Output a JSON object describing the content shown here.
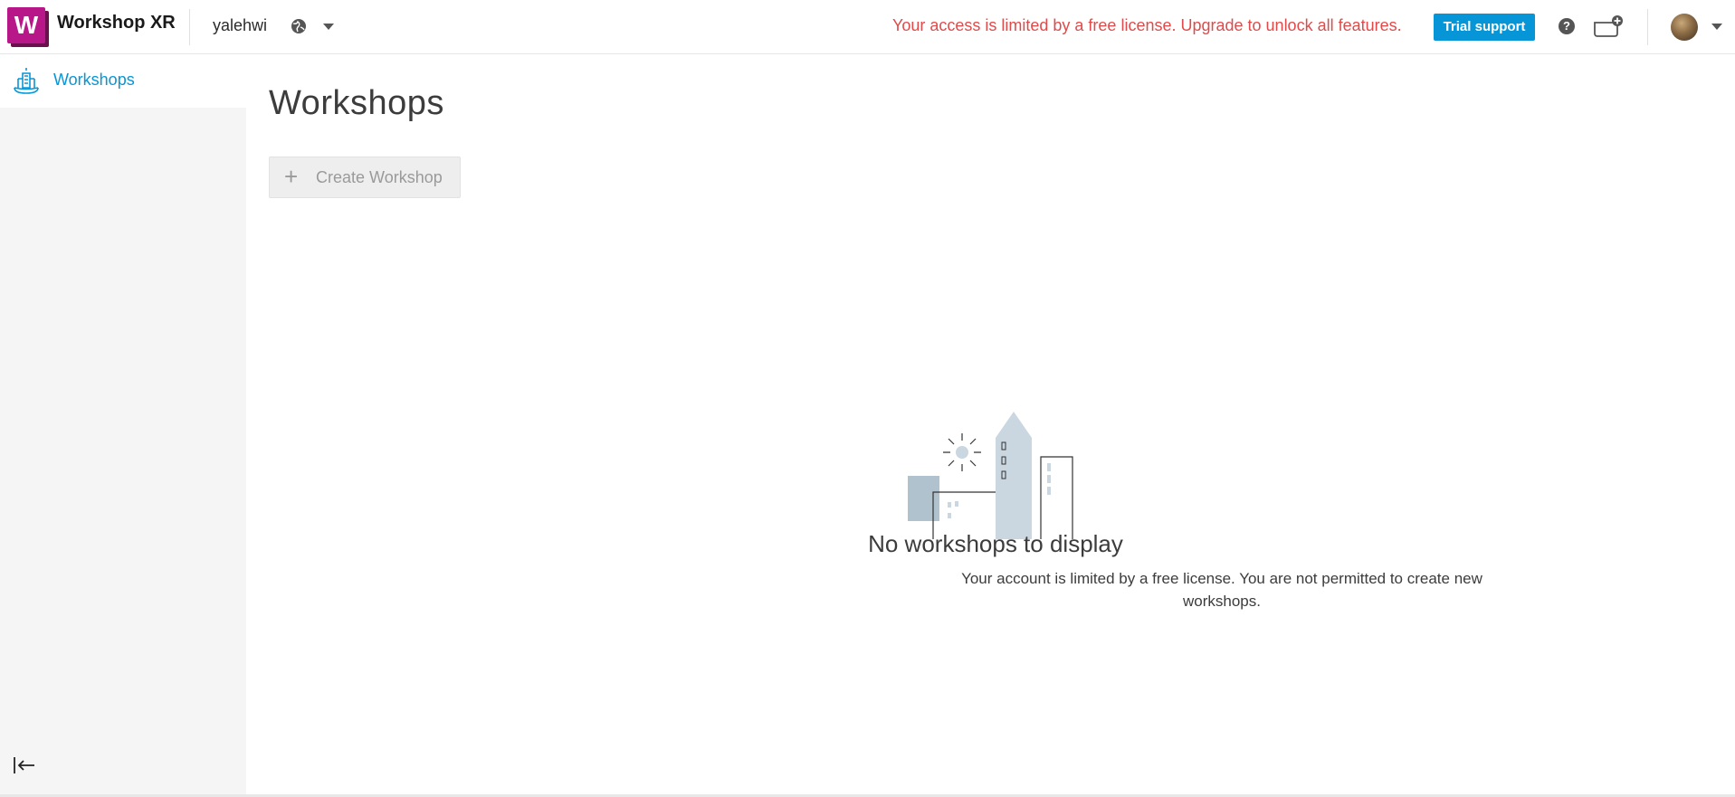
{
  "header": {
    "logo_letter": "W",
    "app_title": "Workshop XR",
    "account_name": "yalehwi",
    "license_notice": "Your access is limited by a free license. Upgrade to unlock all features.",
    "trial_support_label": "Trial support",
    "help_glyph": "?",
    "icons": [
      "globe-icon",
      "chevron-down-icon",
      "help-icon",
      "cart-add-icon",
      "avatar"
    ]
  },
  "sidebar": {
    "items": [
      {
        "label": "Workshops",
        "icon": "workshop-building-icon",
        "active": true
      }
    ],
    "collapse_icon": "collapse-left-icon"
  },
  "main": {
    "title": "Workshops",
    "create_button": {
      "label": "Create Workshop",
      "icon": "plus-icon",
      "disabled": true
    },
    "empty_state": {
      "illustration": "city-buildings-illustration",
      "title": "No workshops to display",
      "message": "Your account is limited by a free license. You are not permitted to create new workshops."
    }
  },
  "colors": {
    "accent": "#0696d7",
    "notice": "#e14a4a",
    "logo": "#b8178a",
    "sidebar_bg": "#f5f5f5"
  }
}
